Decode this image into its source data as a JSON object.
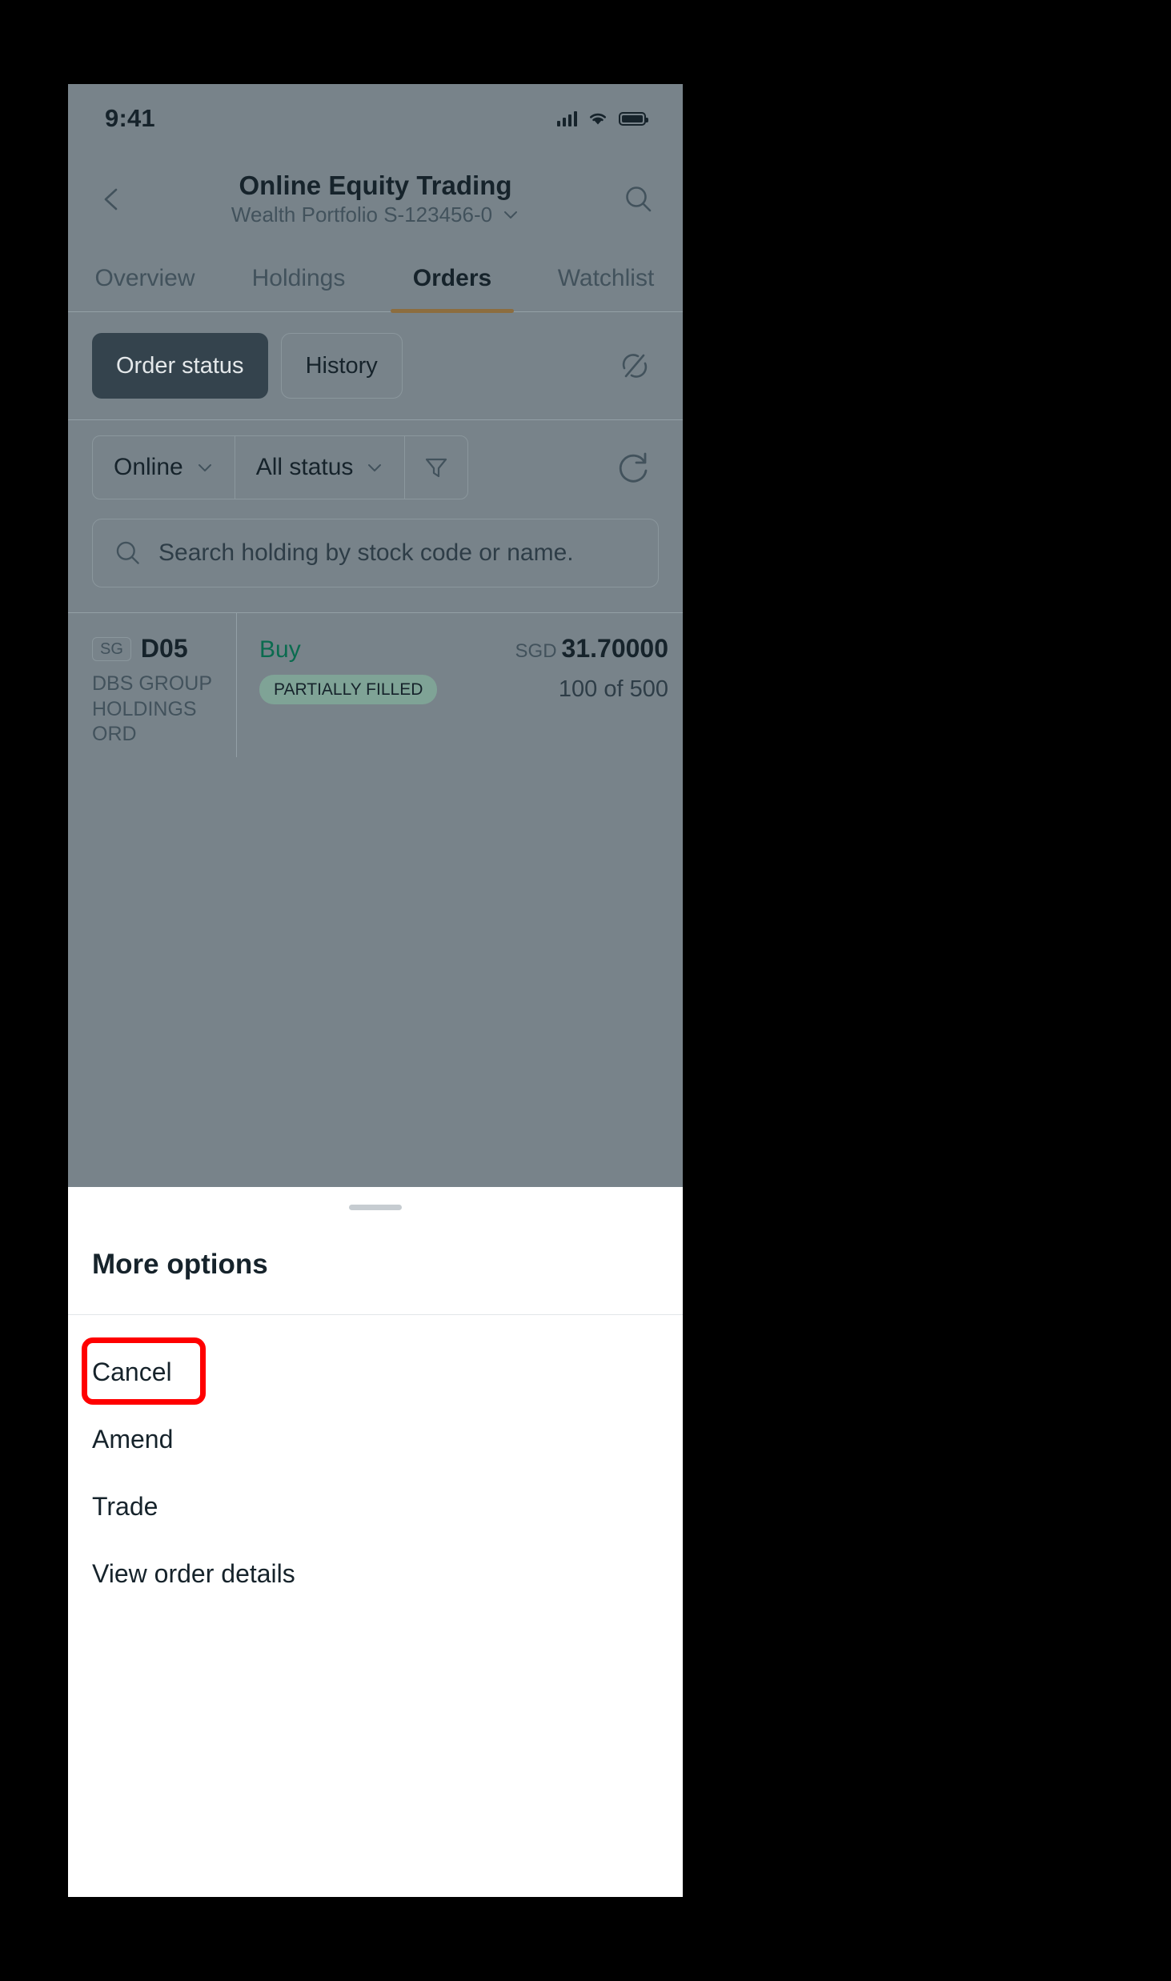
{
  "status_bar": {
    "time": "9:41",
    "icons": [
      "cellular-signal-icon",
      "wifi-icon",
      "battery-icon"
    ]
  },
  "header": {
    "back_icon": "chevron-left-icon",
    "title": "Online Equity Trading",
    "subtitle": "Wealth Portfolio S-123456-0",
    "subtitle_chevron": "chevron-down-icon",
    "search_icon": "search-icon"
  },
  "tabs": [
    {
      "label": "Overview",
      "active": false
    },
    {
      "label": "Holdings",
      "active": false
    },
    {
      "label": "Orders",
      "active": true
    },
    {
      "label": "Watchlist",
      "active": false
    }
  ],
  "segmented": {
    "options": [
      {
        "label": "Order status",
        "active": true
      },
      {
        "label": "History",
        "active": false
      }
    ],
    "trailing_icon": "swap-shares-icon"
  },
  "filters": {
    "channel": {
      "label": "Online",
      "chevron": "chevron-down-icon"
    },
    "status": {
      "label": "All status",
      "chevron": "chevron-down-icon"
    },
    "funnel_icon": "filter-funnel-icon",
    "refresh_icon": "refresh-icon"
  },
  "search": {
    "icon": "search-icon",
    "placeholder": "Search holding by stock code or name."
  },
  "order": {
    "market_badge": "SG",
    "stock_code": "D05",
    "stock_name": "DBS GROUP HOLDINGS ORD",
    "side": "Buy",
    "status": "PARTIALLY FILLED",
    "currency": "SGD",
    "price": "31.70000",
    "quantity": "100 of 500"
  },
  "sheet": {
    "title": "More options",
    "items": [
      {
        "label": "Cancel",
        "highlighted": true
      },
      {
        "label": "Amend",
        "highlighted": false
      },
      {
        "label": "Trade",
        "highlighted": false
      },
      {
        "label": "View order details",
        "highlighted": false
      }
    ]
  },
  "colors": {
    "accent_gold": "#8c6d3f",
    "buy_green": "#0b6b4f",
    "highlight_red": "#ff0000",
    "dark_pill": "#34434d"
  }
}
